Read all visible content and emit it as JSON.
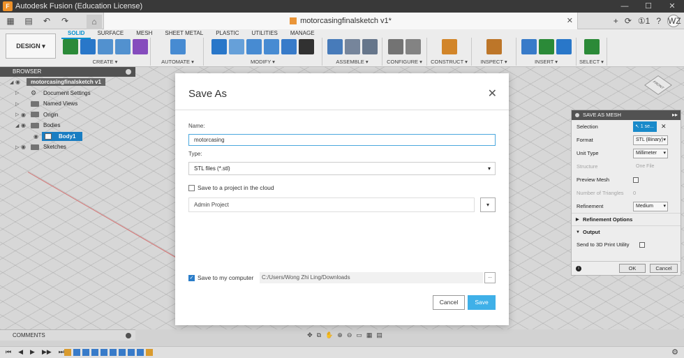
{
  "app": {
    "title": "Autodesk Fusion (Education License)",
    "logo_letter": "F",
    "window_buttons": [
      "—",
      "☐",
      "✕"
    ]
  },
  "tabbar": {
    "quick_access": [
      "▦",
      "▤",
      "↶",
      "↷"
    ],
    "home_icon": "⌂",
    "document_tab": "motorcasingfinalsketch v1*",
    "tab_close": "✕",
    "right_icons": [
      "+",
      "⟳",
      "①1",
      "?"
    ],
    "avatar": "WZ"
  },
  "ribbon": {
    "design_button": "DESIGN ▾",
    "workspace_tabs": [
      "SOLID",
      "SURFACE",
      "MESH",
      "SHEET METAL",
      "PLASTIC",
      "UTILITIES",
      "MANAGE"
    ],
    "active_tab": "SOLID",
    "groups": [
      {
        "label": "CREATE ▾",
        "colors": [
          "#2d8f3a",
          "#2b7bd0",
          "#5596d6",
          "#5596d6",
          "#8a4fc4"
        ]
      },
      {
        "label": "AUTOMATE ▾",
        "colors": [
          "#4a90d9"
        ]
      },
      {
        "label": "MODIFY ▾",
        "colors": [
          "#2b7bd0",
          "#6aa6e0",
          "#4a90d9",
          "#4a90d9",
          "#3a7fd0",
          "#333333"
        ]
      },
      {
        "label": "ASSEMBLE ▾",
        "colors": [
          "#4a7fc0",
          "#7a8aa0",
          "#6a7a90"
        ]
      },
      {
        "label": "CONFIGURE ▾",
        "colors": [
          "#777777",
          "#888888"
        ]
      },
      {
        "label": "CONSTRUCT ▾",
        "colors": [
          "#d98a2b"
        ]
      },
      {
        "label": "INSPECT ▾",
        "colors": [
          "#c47a2b"
        ]
      },
      {
        "label": "INSERT ▾",
        "colors": [
          "#3a7fd0",
          "#2d8f3a",
          "#2b7bd0"
        ]
      },
      {
        "label": "SELECT ▾",
        "colors": [
          "#2d8f3a"
        ]
      }
    ]
  },
  "browser": {
    "header": "BROWSER",
    "root": "motorcasingfinalsketch v1",
    "items": [
      {
        "label": "Document Settings",
        "type": "gear"
      },
      {
        "label": "Named Views",
        "type": "folder"
      },
      {
        "label": "Origin",
        "type": "folder"
      },
      {
        "label": "Bodies",
        "type": "folder"
      },
      {
        "label": "Body1",
        "type": "body"
      },
      {
        "label": "Sketches",
        "type": "folder"
      }
    ]
  },
  "navcube": {
    "face_label": "FRONT"
  },
  "mesh_panel": {
    "header": "SAVE AS MESH",
    "expand": "▸▸",
    "selection_label": "Selection",
    "selection_value": "↖ 1 se...",
    "selection_clear": "✕",
    "format_label": "Format",
    "format_value": "STL (Binary)",
    "unit_label": "Unit Type",
    "unit_value": "Millimeter",
    "structure_label": "Structure",
    "structure_value": "One File",
    "preview_label": "Preview Mesh",
    "triangles_label": "Number of Triangles",
    "triangles_value": "0",
    "refinement_label": "Refinement",
    "refinement_value": "Medium",
    "refinement_options": "Refinement Options",
    "output": "Output",
    "send_label": "Send to 3D Print Utility",
    "info": "i",
    "ok": "OK",
    "cancel": "Cancel"
  },
  "dialog": {
    "title": "Save As",
    "close": "✕",
    "name_label": "Name:",
    "name_value": "motorcasing",
    "type_label": "Type:",
    "type_value": "STL files (*.stl)",
    "type_arrow": "▾",
    "cloud_label": "Save to a project in the cloud",
    "project_value": "Admin Project",
    "project_arrow": "▾",
    "computer_label": "Save to my computer",
    "computer_checked": "✓",
    "path_value": "C:/Users/Wong Zhi Ling/Downloads",
    "browse_label": "...",
    "cancel": "Cancel",
    "save": "Save"
  },
  "bottom": {
    "comments": "COMMENTS",
    "nav_icons": [
      "✥",
      "⧉",
      "✋",
      "⊕",
      "⊖",
      "▭",
      "▦",
      "▤"
    ],
    "timeline_controls": [
      "⏮",
      "◀",
      "▶",
      "▶▶",
      "⏭"
    ],
    "timeline_colors": [
      "#e0a030",
      "#3a7fd0",
      "#3a7fd0",
      "#3a7fd0",
      "#3a7fd0",
      "#3a7fd0",
      "#3a7fd0",
      "#3a7fd0",
      "#3a7fd0",
      "#e0a030"
    ],
    "settings_icon": "⚙"
  }
}
